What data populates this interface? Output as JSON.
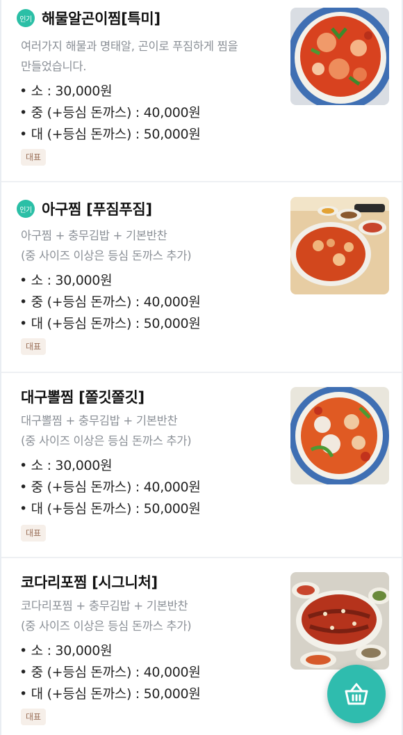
{
  "popular_badge": "인기",
  "menu": [
    {
      "title": "해물알곤이찜[특미]",
      "popular": true,
      "desc": [
        "여러가지 해물과 명태알, 곤이로 푸짐하게 찜을",
        "만들었습니다."
      ],
      "prices": [
        "• 소 : 30,000원",
        "• 중 (+등심 돈까스) : 40,000원",
        "• 대 (+등심 돈까스) : 50,000원"
      ],
      "tag": "대표"
    },
    {
      "title": "아구찜 [푸짐푸짐]",
      "popular": true,
      "desc": [
        "아구찜 + 충무김밥 + 기본반찬",
        "(중 사이즈 이상은 등심 돈까스 추가)"
      ],
      "prices": [
        "• 소 : 30,000원",
        "• 중 (+등심 돈까스) : 40,000원",
        "• 대 (+등심 돈까스) : 50,000원"
      ],
      "tag": "대표"
    },
    {
      "title": "대구뽈찜 [쫄깃쫄깃]",
      "popular": false,
      "desc": [
        "대구뽈찜 + 충무김밥 + 기본반찬",
        "(중 사이즈 이상은 등심 돈까스 추가)"
      ],
      "prices": [
        "• 소 : 30,000원",
        "• 중 (+등심 돈까스) : 40,000원",
        "• 대 (+등심 돈까스) : 50,000원"
      ],
      "tag": "대표"
    },
    {
      "title": "코다리포찜 [시그니처]",
      "popular": false,
      "desc": [
        "코다리포찜 + 충무김밥 + 기본반찬",
        "(중 사이즈 이상은 등심 돈까스 추가)"
      ],
      "prices": [
        "• 소 : 30,000원",
        "• 중 (+등심 돈까스) : 40,000원",
        "• 대 (+등심 돈까스) : 50,000원"
      ],
      "tag": "대표"
    }
  ],
  "icons": {
    "popular_badge": "popular-badge-icon",
    "cart": "basket-icon"
  },
  "colors": {
    "accent": "#2bbfa6",
    "fab": "#2fbcae",
    "tag_bg": "#f6efe9",
    "tag_text": "#9a6f58",
    "desc_text": "#8a8f96"
  }
}
